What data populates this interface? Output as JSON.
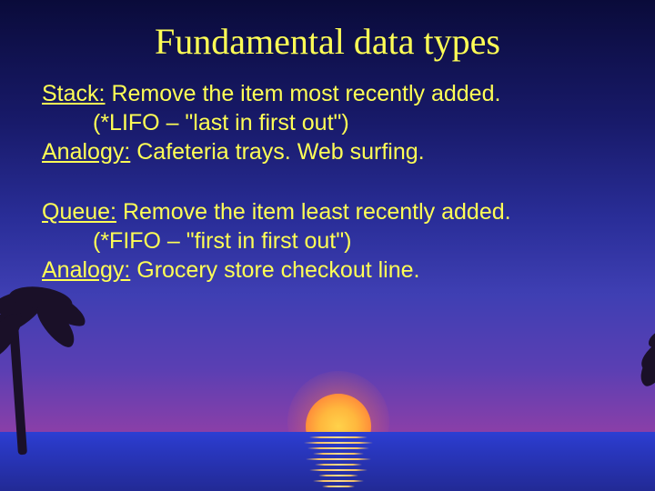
{
  "title": "Fundamental data types",
  "stack": {
    "label": "Stack:",
    "desc": "Remove the item most recently added.",
    "note": "(*LIFO – \"last in first out\")",
    "analogy_label": "Analogy:",
    "analogy": "Cafeteria trays. Web surfing."
  },
  "queue": {
    "label": "Queue:",
    "desc": "Remove the item least recently added.",
    "note": "(*FIFO – \"first in first out\")",
    "analogy_label": "Analogy:",
    "analogy": "Grocery store checkout line."
  }
}
